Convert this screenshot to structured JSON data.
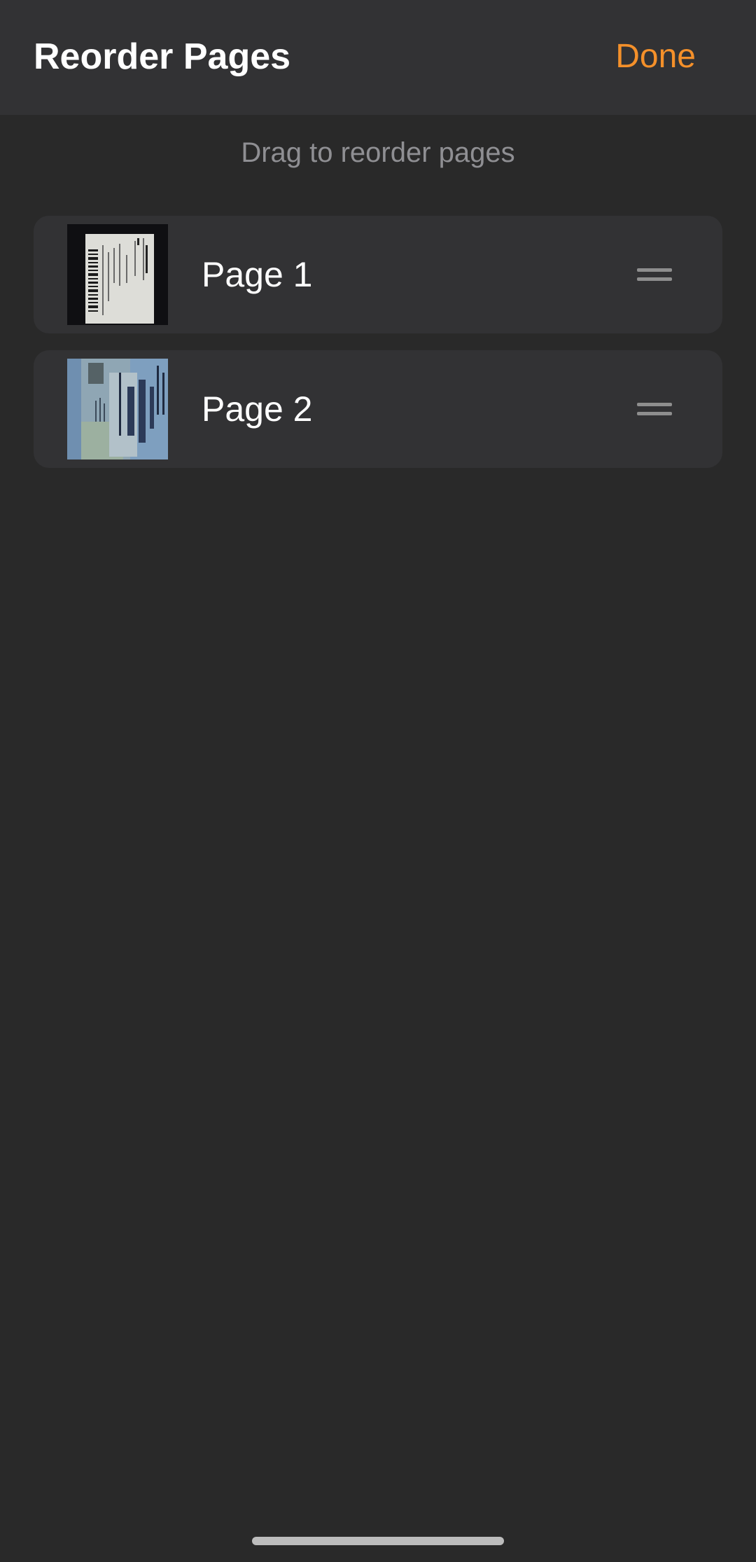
{
  "header": {
    "title": "Reorder Pages",
    "done_label": "Done"
  },
  "hint": "Drag to reorder pages",
  "pages": [
    {
      "label": "Page 1",
      "thumbnail_icon": "receipt-thumbnail"
    },
    {
      "label": "Page 2",
      "thumbnail_icon": "id-card-thumbnail"
    }
  ],
  "colors": {
    "background": "#292929",
    "header_background": "#323234",
    "row_background": "#323234",
    "accent": "#f4902a",
    "hint_text": "#8f8f93",
    "handle": "#8e8e8e"
  }
}
